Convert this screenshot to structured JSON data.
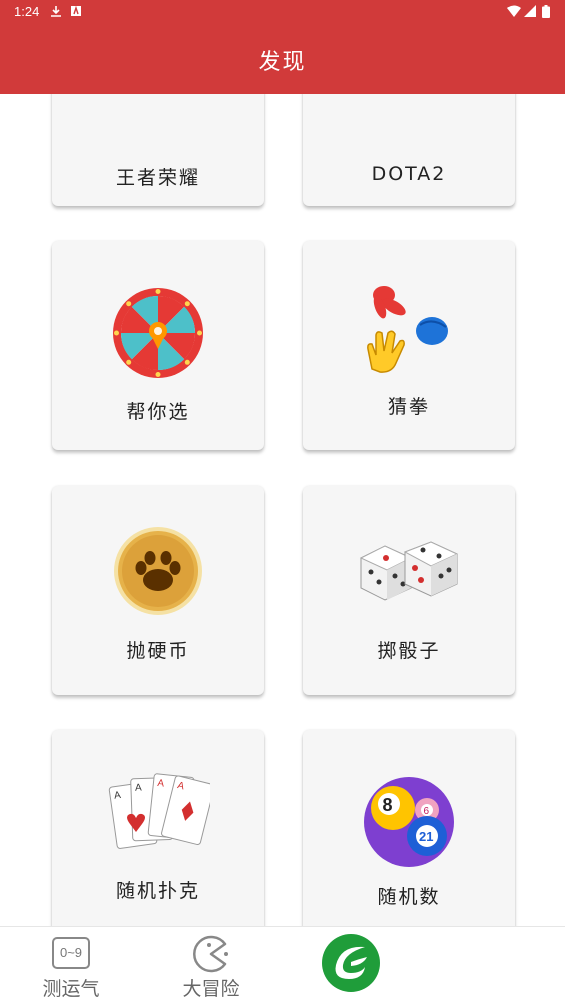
{
  "status_bar": {
    "time": "1:24"
  },
  "app_bar": {
    "title": "发现"
  },
  "cards": [
    {
      "id": "wzry",
      "label": "王者荣耀"
    },
    {
      "id": "dota2",
      "label": "DOTA2"
    },
    {
      "id": "bangnixuan",
      "label": "帮你选",
      "icon": "prize-wheel-icon"
    },
    {
      "id": "caiquan",
      "label": "猜拳",
      "icon": "rock-paper-scissors-icon"
    },
    {
      "id": "paoyingbi",
      "label": "抛硬币",
      "icon": "coin-icon"
    },
    {
      "id": "zhitouzi",
      "label": "掷骰子",
      "icon": "dice-icon"
    },
    {
      "id": "suijipuke",
      "label": "随机扑克",
      "icon": "playing-cards-icon"
    },
    {
      "id": "suijishu",
      "label": "随机数",
      "icon": "billiard-balls-icon"
    }
  ],
  "bottom_nav": [
    {
      "id": "luck",
      "label": "测运气",
      "icon": "number-range-icon",
      "icon_text": "0~9"
    },
    {
      "id": "adventure",
      "label": "大冒险",
      "icon": "pacman-icon"
    },
    {
      "id": "discover",
      "label": "",
      "icon": "leaf-logo-icon",
      "active": true
    }
  ],
  "colors": {
    "primary": "#d13a3a",
    "card_bg": "#f6f6f6",
    "accent_green": "#1f9d3a"
  }
}
